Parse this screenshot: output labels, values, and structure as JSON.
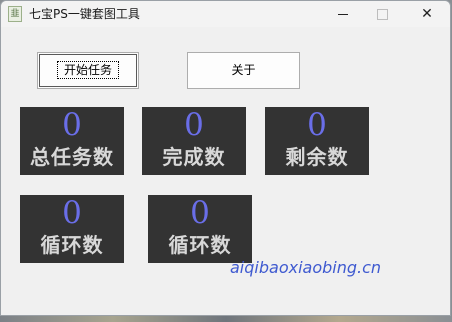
{
  "window": {
    "title": "七宝PS一键套图工具",
    "icon": "app-icon",
    "icon_glyph": "⾲",
    "controls": {
      "minimize": "minimize-icon",
      "maximize": "maximize-icon",
      "close_glyph": "✕"
    }
  },
  "buttons": {
    "start": "开始任务",
    "about": "关于"
  },
  "stats": [
    {
      "value": "0",
      "label": "总任务数"
    },
    {
      "value": "0",
      "label": "完成数"
    },
    {
      "value": "0",
      "label": "剩余数"
    },
    {
      "value": "0",
      "label": "循环数"
    },
    {
      "value": "0",
      "label": "循环数"
    }
  ],
  "watermark": "aiqibaoxiaobing.cn",
  "colors": {
    "panel": "#333333",
    "number": "#6a6ee8",
    "label": "#d8d8d8",
    "watermark": "#3f5ad0"
  }
}
